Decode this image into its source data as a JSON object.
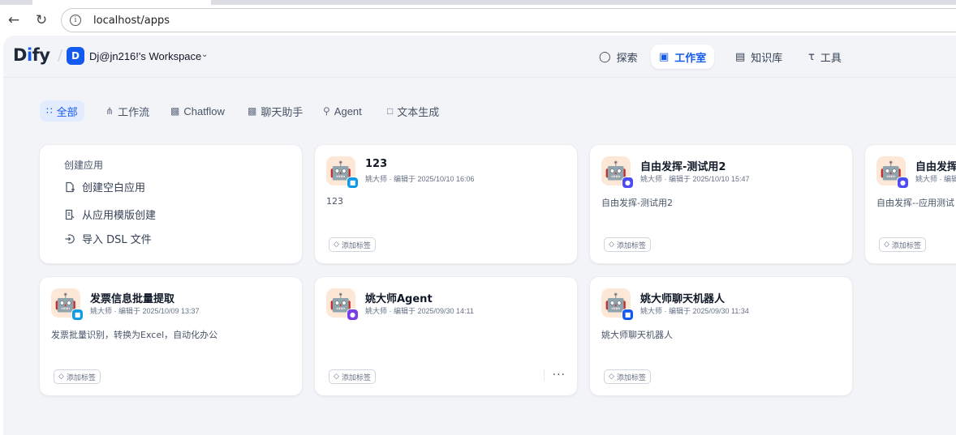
{
  "browser": {
    "url": "localhost/apps"
  },
  "header": {
    "logo": {
      "left": "D",
      "mid": "i",
      "right": "fy"
    },
    "workspace_badge": "D",
    "workspace_name": "Dj@jn216!'s Workspace",
    "nav": {
      "explore": "探索",
      "studio": "工作室",
      "knowledge": "知识库",
      "tools": "工具"
    }
  },
  "filters": {
    "all": "全部",
    "workflow": "工作流",
    "chatflow": "Chatflow",
    "chat_assistant": "聊天助手",
    "agent": "Agent",
    "text_gen": "文本生成"
  },
  "create_card": {
    "title": "创建应用",
    "blank": "创建空白应用",
    "template": "从应用模版创建",
    "import_dsl": "导入 DSL 文件"
  },
  "apps": [
    {
      "title": "123",
      "meta": "姚大师 · 编辑于 2025/10/10 16:06",
      "desc": "123",
      "tag": "添加标签"
    },
    {
      "title": "自由发挥-测试用2",
      "meta": "姚大师 · 编辑于 2025/10/10 15:47",
      "desc": "自由发挥-测试用2",
      "tag": "添加标签"
    },
    {
      "title": "自由发挥",
      "meta": "姚大师 · 编辑",
      "desc": "自由发挥--应用测试",
      "tag": "添加标签"
    },
    {
      "title": "发票信息批量提取",
      "meta": "姚大师 · 编辑于 2025/10/09 13:37",
      "desc": "发票批量识别，转换为Excel，自动化办公",
      "tag": "添加标签"
    },
    {
      "title": "姚大师Agent",
      "meta": "姚大师 · 编辑于 2025/09/30 14:11",
      "desc": "",
      "tag": "添加标签",
      "more": "···"
    },
    {
      "title": "姚大师聊天机器人",
      "meta": "姚大师 · 编辑于 2025/09/30 11:34",
      "desc": "姚大师聊天机器人",
      "tag": "添加标签"
    }
  ],
  "colors": {
    "accent": "#155aef",
    "background": "#f2f4f7"
  }
}
